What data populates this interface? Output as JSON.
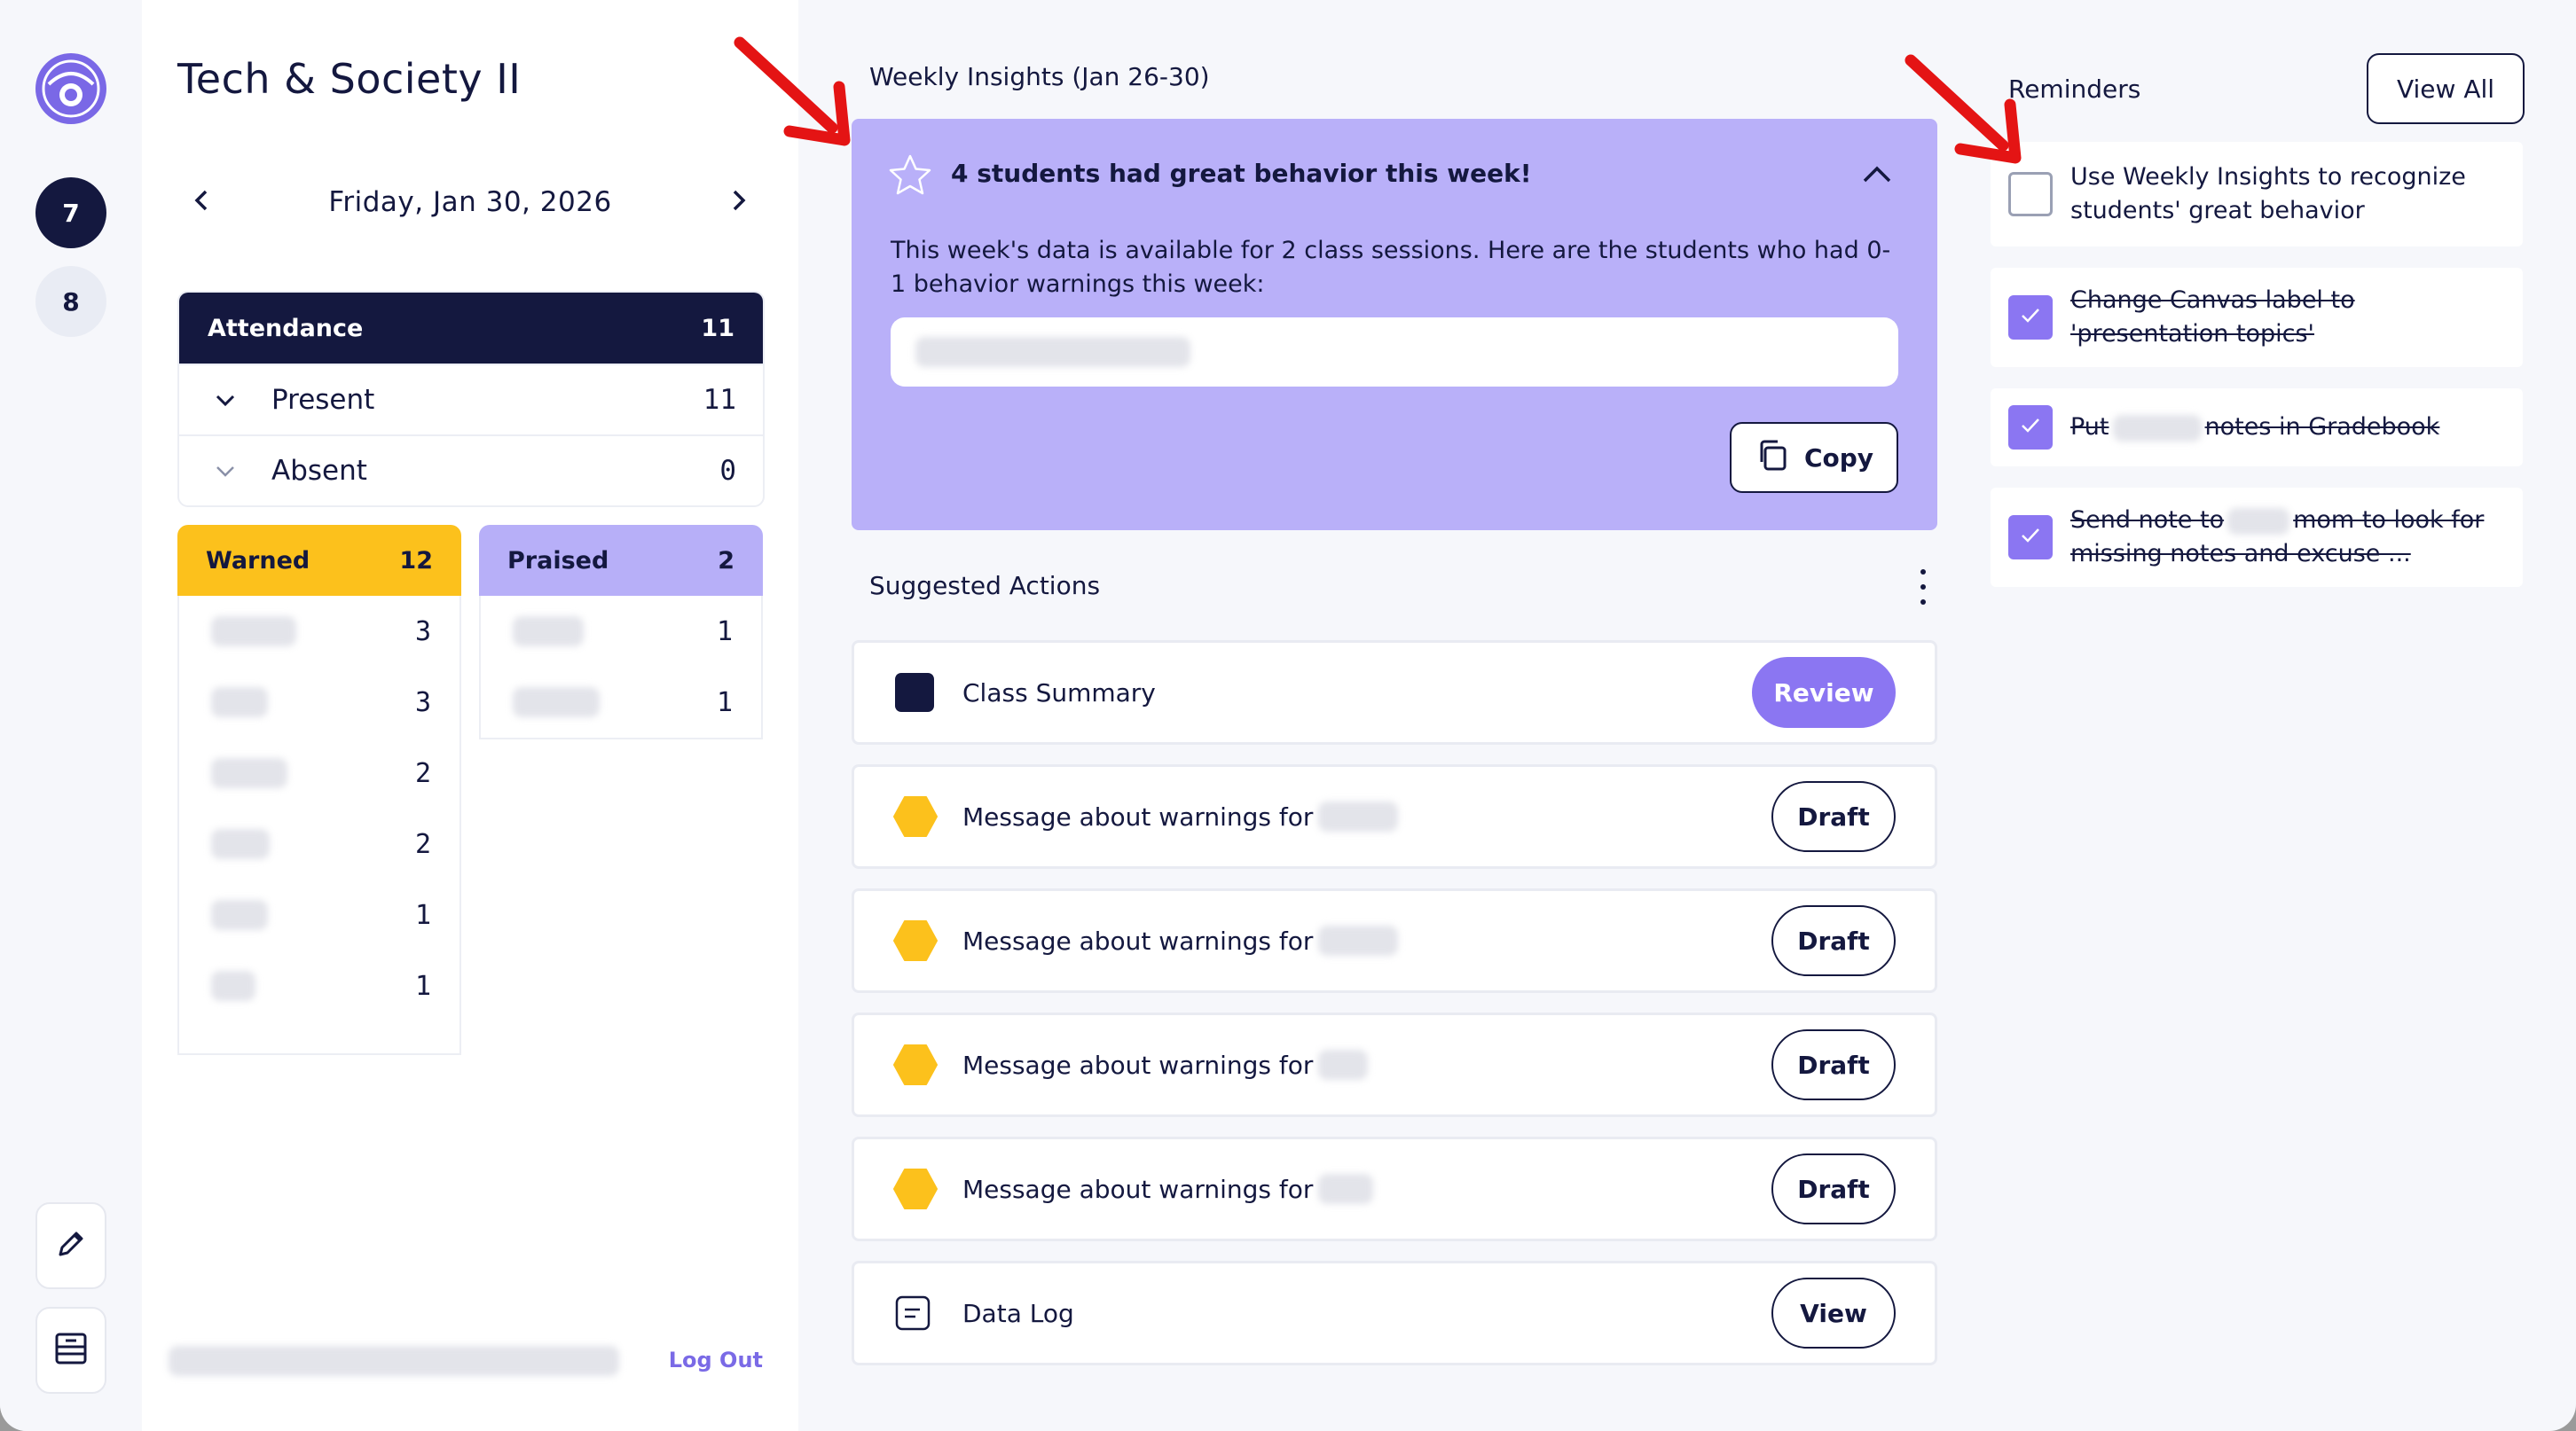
{
  "sidebar": {
    "periods": [
      "7",
      "8"
    ]
  },
  "class_panel": {
    "title": "Tech & Society II",
    "date": "Friday, Jan 30, 2026",
    "attendance": {
      "label": "Attendance",
      "total": "11",
      "rows": [
        {
          "label": "Present",
          "count": "11"
        },
        {
          "label": "Absent",
          "count": "0"
        }
      ]
    },
    "warned": {
      "label": "Warned",
      "total": "12",
      "counts": [
        "3",
        "3",
        "2",
        "2",
        "1",
        "1"
      ]
    },
    "praised": {
      "label": "Praised",
      "total": "2",
      "counts": [
        "1",
        "1"
      ]
    },
    "logout_label": "Log Out"
  },
  "insights": {
    "heading": "Weekly Insights (Jan 26-30)",
    "title": "4 students had great behavior this week!",
    "text": "This week's data is available for 2 class sessions. Here are the students who had 0-1 behavior warnings this week:",
    "copy_label": "Copy"
  },
  "suggested_actions": {
    "heading": "Suggested Actions",
    "items": [
      {
        "label": "Class Summary",
        "button": "Review",
        "icon": "square-icon"
      },
      {
        "label": "Message about warnings for",
        "button": "Draft",
        "icon": "hexagon-icon"
      },
      {
        "label": "Message about warnings for",
        "button": "Draft",
        "icon": "hexagon-icon"
      },
      {
        "label": "Message about warnings for",
        "button": "Draft",
        "icon": "hexagon-icon"
      },
      {
        "label": "Message about warnings for",
        "button": "Draft",
        "icon": "hexagon-icon"
      },
      {
        "label": "Data Log",
        "button": "View",
        "icon": "document-icon"
      }
    ]
  },
  "reminders": {
    "heading": "Reminders",
    "view_all_label": "View All",
    "items": [
      {
        "text": "Use Weekly Insights to recognize students' great behavior",
        "done": false
      },
      {
        "text": "Change Canvas label to 'presentation topics'",
        "done": true
      },
      {
        "text_before": "Put",
        "text_after": "notes in Gradebook",
        "done": true
      },
      {
        "text_before": "Send note to",
        "text_after": "mom to look for missing notes and excuse ...",
        "done": true
      }
    ]
  },
  "colors": {
    "navy": "#14183f",
    "lavender": "#b9b0f9",
    "purple": "#8b76f2",
    "yellow": "#fcc11c",
    "arrow_red": "#e41414"
  }
}
